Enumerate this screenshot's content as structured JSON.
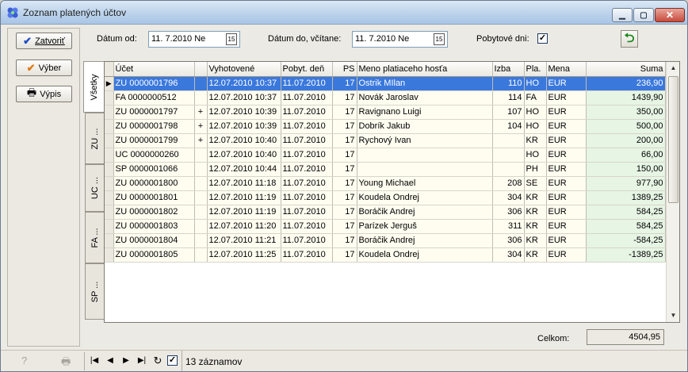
{
  "window": {
    "title": "Zoznam platených účtov"
  },
  "left_buttons": {
    "close": "Zatvoriť",
    "select": "Výber",
    "print": "Výpis"
  },
  "filters": {
    "date_from_label": "Dátum od:",
    "date_from_value": "11. 7.2010  Ne",
    "date_to_label": "Dátum do, včítane:",
    "date_to_value": "11. 7.2010  Ne",
    "stay_days_label": "Pobytové dni:",
    "stay_days_checked": true
  },
  "tabs": [
    "Všetky",
    "ZU ...",
    "UC ...",
    "FA ...",
    "SP ..."
  ],
  "columns": [
    "Účet",
    "",
    "Vyhotovené",
    "Pobyt. deň",
    "PS",
    "Meno platiaceho hosťa",
    "Izba",
    "Pla.",
    "Mena",
    "Suma"
  ],
  "rows": [
    [
      "ZU 0000001796",
      "",
      "12.07.2010 10:37",
      "11.07.2010",
      "17",
      "Ostrik MIlan",
      "110",
      "HO",
      "EUR",
      "236,90"
    ],
    [
      "FA 0000000512",
      "",
      "12.07.2010 10:37",
      "11.07.2010",
      "17",
      "Novák Jaroslav",
      "114",
      "FA",
      "EUR",
      "1439,90"
    ],
    [
      "ZU 0000001797",
      "+",
      "12.07.2010 10:39",
      "11.07.2010",
      "17",
      "Ravignano Luigi",
      "107",
      "HO",
      "EUR",
      "350,00"
    ],
    [
      "ZU 0000001798",
      "+",
      "12.07.2010 10:39",
      "11.07.2010",
      "17",
      "Dobrík Jakub",
      "104",
      "HO",
      "EUR",
      "500,00"
    ],
    [
      "ZU 0000001799",
      "+",
      "12.07.2010 10:40",
      "11.07.2010",
      "17",
      "Rychový Ivan",
      "",
      "KR",
      "EUR",
      "200,00"
    ],
    [
      "UC 0000000260",
      "",
      "12.07.2010 10:40",
      "11.07.2010",
      "17",
      "",
      "",
      "HO",
      "EUR",
      "66,00"
    ],
    [
      "SP 0000001066",
      "",
      "12.07.2010 10:44",
      "11.07.2010",
      "17",
      "",
      "",
      "PH",
      "EUR",
      "150,00"
    ],
    [
      "ZU 0000001800",
      "",
      "12.07.2010 11:18",
      "11.07.2010",
      "17",
      "Young Michael",
      "208",
      "SE",
      "EUR",
      "977,90"
    ],
    [
      "ZU 0000001801",
      "",
      "12.07.2010 11:19",
      "11.07.2010",
      "17",
      "Koudela Ondrej",
      "304",
      "KR",
      "EUR",
      "1389,25"
    ],
    [
      "ZU 0000001802",
      "",
      "12.07.2010 11:19",
      "11.07.2010",
      "17",
      "Boráčik Andrej",
      "306",
      "KR",
      "EUR",
      "584,25"
    ],
    [
      "ZU 0000001803",
      "",
      "12.07.2010 11:20",
      "11.07.2010",
      "17",
      "Parízek Jerguš",
      "311",
      "KR",
      "EUR",
      "584,25"
    ],
    [
      "ZU 0000001804",
      "",
      "12.07.2010 11:21",
      "11.07.2010",
      "17",
      "Boráčik Andrej",
      "306",
      "KR",
      "EUR",
      "-584,25"
    ],
    [
      "ZU 0000001805",
      "",
      "12.07.2010 11:25",
      "11.07.2010",
      "17",
      "Koudela Ondrej",
      "304",
      "KR",
      "EUR",
      "-1389,25"
    ]
  ],
  "selected_row": 0,
  "total": {
    "label": "Celkom:",
    "value": "4504,95"
  },
  "status": {
    "record_count": "13 záznamov",
    "filter_checked": true
  },
  "colors": {
    "selection": "#3a78dc",
    "row_bg": "#fffdf0",
    "sum_bg": "#e6f5e4",
    "accent_green": "#1a8a1a"
  }
}
